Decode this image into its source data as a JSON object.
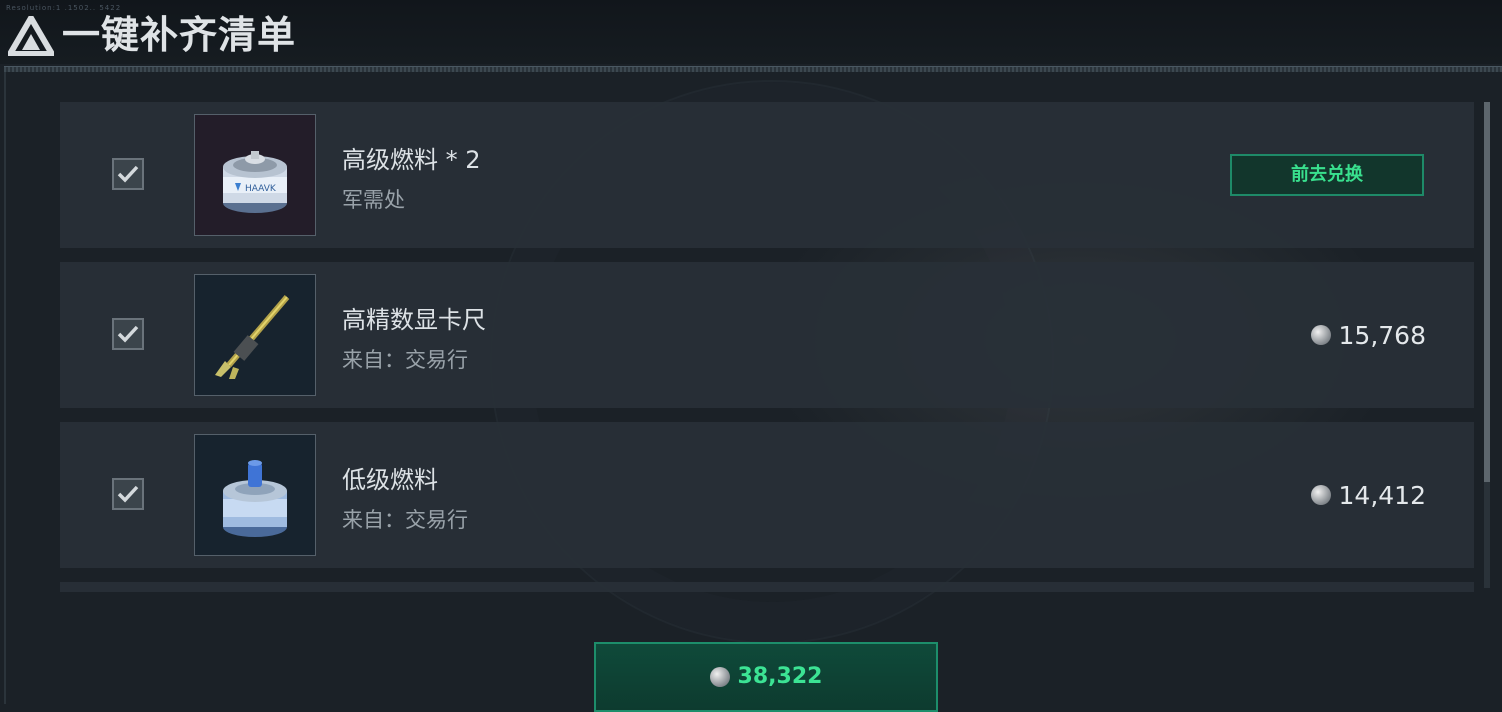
{
  "header": {
    "title": "一键补齐清单",
    "tiny_text": "Resolution:1 .1502.. 5422",
    "logo_icon": "triangle-logo-icon"
  },
  "items": [
    {
      "name": "高级燃料 * 2",
      "source": "军需处",
      "checked": true,
      "action_label": "前去兑换",
      "icon": "premium-fuel-can-icon"
    },
    {
      "name": "高精数显卡尺",
      "source": "来自：交易行",
      "checked": true,
      "price": "15,768",
      "icon": "digital-caliper-icon"
    },
    {
      "name": "低级燃料",
      "source": "来自：交易行",
      "checked": true,
      "price": "14,412",
      "icon": "basic-fuel-can-icon"
    }
  ],
  "total": {
    "value": "38,322",
    "icon": "coin-icon"
  },
  "colors": {
    "accent_green": "#39e08e",
    "button_border": "#1e8a68",
    "background": "#1b2127",
    "row_background": "#283037"
  }
}
